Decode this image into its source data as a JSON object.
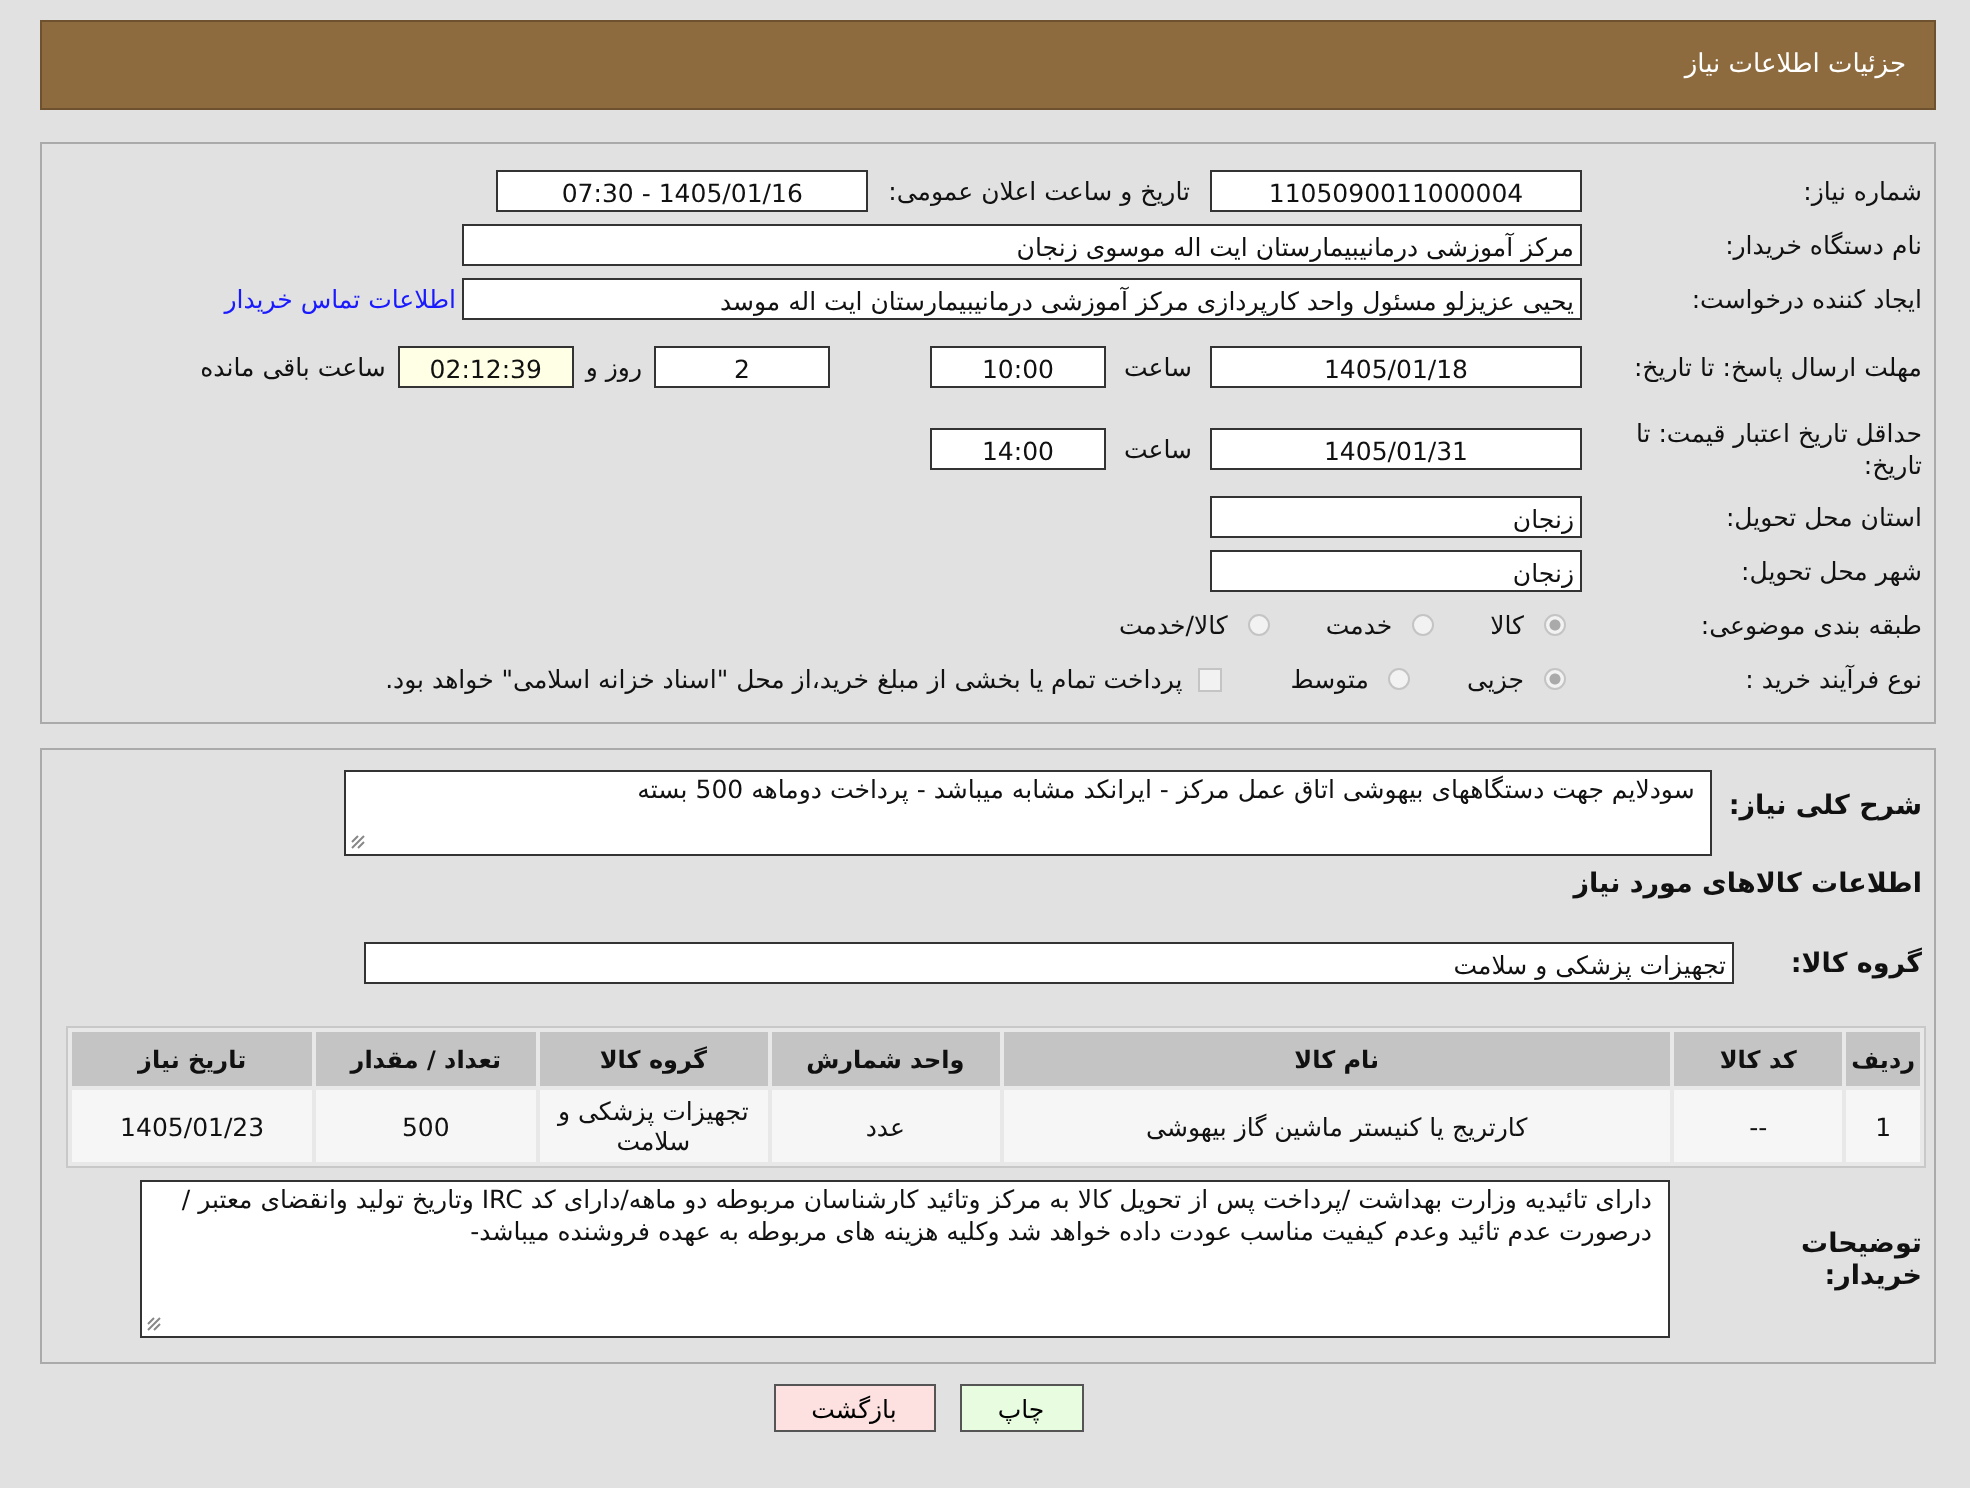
{
  "header": {
    "title": "جزئیات اطلاعات نیاز"
  },
  "need_number": {
    "label": "شماره نیاز:",
    "value": "1105090011000004"
  },
  "announce": {
    "label": "تاریخ و ساعت اعلان عمومی:",
    "value": "1405/01/16 - 07:30"
  },
  "buyer_org": {
    "label": "نام دستگاه خریدار:",
    "value": "مرکز آموزشی درمانیبیمارستان ایت اله موسوی زنجان"
  },
  "requester": {
    "label": "ایجاد کننده درخواست:",
    "value": "یحیی عزیزلو مسئول واحد کارپردازی مرکز آموزشی درمانیبیمارستان ایت اله موسد",
    "link": "اطلاعات تماس خریدار"
  },
  "deadline": {
    "label": "مهلت ارسال پاسخ: تا تاریخ:",
    "date": "1405/01/18",
    "time_label": "ساعت",
    "time": "10:00",
    "days": "2",
    "days_label": "روز و",
    "remaining": "02:12:39",
    "remaining_label": "ساعت باقی مانده"
  },
  "price_validity": {
    "label": "حداقل تاریخ اعتبار قیمت: تا تاریخ:",
    "date": "1405/01/31",
    "time_label": "ساعت",
    "time": "14:00"
  },
  "province": {
    "label": "استان محل تحویل:",
    "value": "زنجان"
  },
  "city": {
    "label": "شهر محل تحویل:",
    "value": "زنجان"
  },
  "category": {
    "label": "طبقه بندی موضوعی:",
    "options": [
      {
        "label": "کالا",
        "selected": true
      },
      {
        "label": "خدمت",
        "selected": false
      },
      {
        "label": "کالا/خدمت",
        "selected": false
      }
    ]
  },
  "process": {
    "label": "نوع فرآیند خرید :",
    "options": [
      {
        "label": "جزیی",
        "selected": true
      },
      {
        "label": "متوسط",
        "selected": false
      }
    ],
    "checkbox": {
      "label": "پرداخت تمام یا بخشی از مبلغ خرید،از محل \"اسناد خزانه اسلامی\" خواهد بود.",
      "checked": false
    }
  },
  "description": {
    "label": "شرح کلی نیاز:",
    "value": "سودلایم جهت دستگاههای بیهوشی  اتاق عمل مرکز - ایرانکد مشابه میباشد - پرداخت دوماهه 500 بسته"
  },
  "goods_title": "اطلاعات کالاهای مورد نیاز",
  "goods_group": {
    "label": "گروه کالا:",
    "value": "تجهیزات پزشکی و سلامت"
  },
  "table": {
    "columns": [
      "ردیف",
      "کد کالا",
      "نام کالا",
      "واحد شمارش",
      "گروه کالا",
      "تعداد / مقدار",
      "تاریخ نیاز"
    ],
    "rows": [
      [
        "1",
        "--",
        "کارتریج یا کنیستر ماشین گاز بیهوشی",
        "عدد",
        "تجهیزات پزشکی و سلامت",
        "500",
        "1405/01/23"
      ]
    ]
  },
  "buyer_notes": {
    "label": "توضیحات خریدار:",
    "value": "دارای تائیدیه وزارت بهداشت  /پرداخت پس از تحویل کالا به مرکز وتائید کارشناسان مربوطه دو ماهه/دارای کد IRC  وتاریخ تولید وانقضای معتبر /درصورت عدم تائید وعدم کیفیت مناسب عودت داده خواهد شد وکلیه هزینه های مربوطه به عهده فروشنده میباشد-"
  },
  "buttons": [
    {
      "label": "چاپ",
      "kind": "print"
    },
    {
      "label": "بازگشت",
      "kind": "back"
    }
  ]
}
